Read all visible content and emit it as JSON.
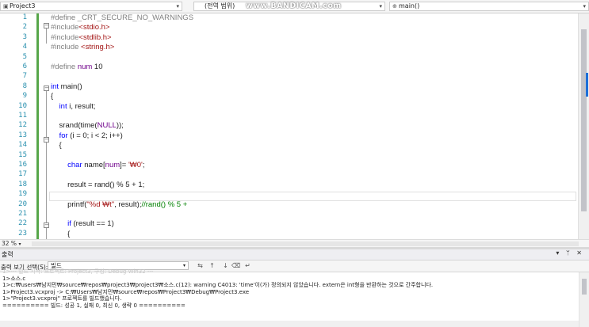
{
  "navbar": {
    "project": "Project3",
    "scope": "(전역 범위)",
    "function": "main()",
    "watermark": "www.BANDICAM.com"
  },
  "editor": {
    "line_numbers": [
      "1",
      "2",
      "3",
      "4",
      "5",
      "6",
      "7",
      "8",
      "9",
      "10",
      "11",
      "12",
      "13",
      "14",
      "15",
      "16",
      "17",
      "18",
      "19",
      "20",
      "21",
      "22",
      "23"
    ],
    "lines": [
      [
        {
          "t": "#define _CRT_SECURE_NO_WARNINGS",
          "c": "pp"
        }
      ],
      [
        {
          "t": "#include",
          "c": "pp"
        },
        {
          "t": "<stdio.h>",
          "c": "str"
        }
      ],
      [
        {
          "t": "#include",
          "c": "pp"
        },
        {
          "t": "<stdlib.h>",
          "c": "str"
        }
      ],
      [
        {
          "t": "#include ",
          "c": "pp"
        },
        {
          "t": "<string.h>",
          "c": "str"
        }
      ],
      [],
      [
        {
          "t": "#define ",
          "c": "pp"
        },
        {
          "t": "num",
          "c": "mac"
        },
        {
          "t": " 10",
          "c": ""
        }
      ],
      [],
      [
        {
          "t": "int",
          "c": "kw"
        },
        {
          "t": " main()",
          "c": ""
        }
      ],
      [
        {
          "t": "{",
          "c": ""
        }
      ],
      [
        {
          "t": "    ",
          "c": ""
        },
        {
          "t": "int",
          "c": "kw"
        },
        {
          "t": " i, result;",
          "c": ""
        }
      ],
      [],
      [
        {
          "t": "    srand(time(",
          "c": ""
        },
        {
          "t": "NULL",
          "c": "mac"
        },
        {
          "t": "));",
          "c": ""
        }
      ],
      [
        {
          "t": "    ",
          "c": ""
        },
        {
          "t": "for",
          "c": "kw"
        },
        {
          "t": " (i = 0; i < 2; i++)",
          "c": ""
        }
      ],
      [
        {
          "t": "    {",
          "c": ""
        }
      ],
      [],
      [
        {
          "t": "        ",
          "c": ""
        },
        {
          "t": "char",
          "c": "kw"
        },
        {
          "t": " name[",
          "c": ""
        },
        {
          "t": "num",
          "c": "mac"
        },
        {
          "t": "]= ",
          "c": ""
        },
        {
          "t": "'₩0'",
          "c": "str"
        },
        {
          "t": ";",
          "c": ""
        }
      ],
      [],
      [
        {
          "t": "        result = rand() % 5 + 1;",
          "c": ""
        }
      ],
      [],
      [
        {
          "t": "        printf(",
          "c": ""
        },
        {
          "t": "\"%d ₩t\"",
          "c": "str"
        },
        {
          "t": ", result);",
          "c": ""
        },
        {
          "t": "//rand() % 5 +",
          "c": "cm"
        }
      ],
      [],
      [
        {
          "t": "        ",
          "c": ""
        },
        {
          "t": "if",
          "c": "kw"
        },
        {
          "t": " (result == 1)",
          "c": ""
        }
      ],
      [
        {
          "t": "        {",
          "c": ""
        }
      ]
    ]
  },
  "status": {
    "zoom": "32 %"
  },
  "output": {
    "title": "출력",
    "controls": "▾ ᛘ ✕",
    "source_label": "출력 보기 선택(S):",
    "source_value": "빌드",
    "lines": [
      {
        "text": "1>--- 빌드 시작: 프로젝트: Project3, 구성: Debug Win32 ---",
        "faded": true
      },
      {
        "text": "1>소스.c",
        "faded": false
      },
      {
        "text": "1>c:₩users₩남지민₩source₩repos₩project3₩project3₩소스.c(12): warning C4013: 'time'이(가) 정의되지 않았습니다. extern은 int형을 반환하는 것으로 간주합니다.",
        "faded": false
      },
      {
        "text": "1>Project3.vcxproj -> C:₩Users₩남지민₩source₩repos₩Project3₩Debug₩Project3.exe",
        "faded": false
      },
      {
        "text": "1>\"Project3.vcxproj\" 프로젝트를 빌드했습니다.",
        "faded": false
      },
      {
        "text": "========== 빌드: 성공 1, 실패 0, 최신 0, 생략 0 ==========",
        "faded": false
      }
    ]
  }
}
